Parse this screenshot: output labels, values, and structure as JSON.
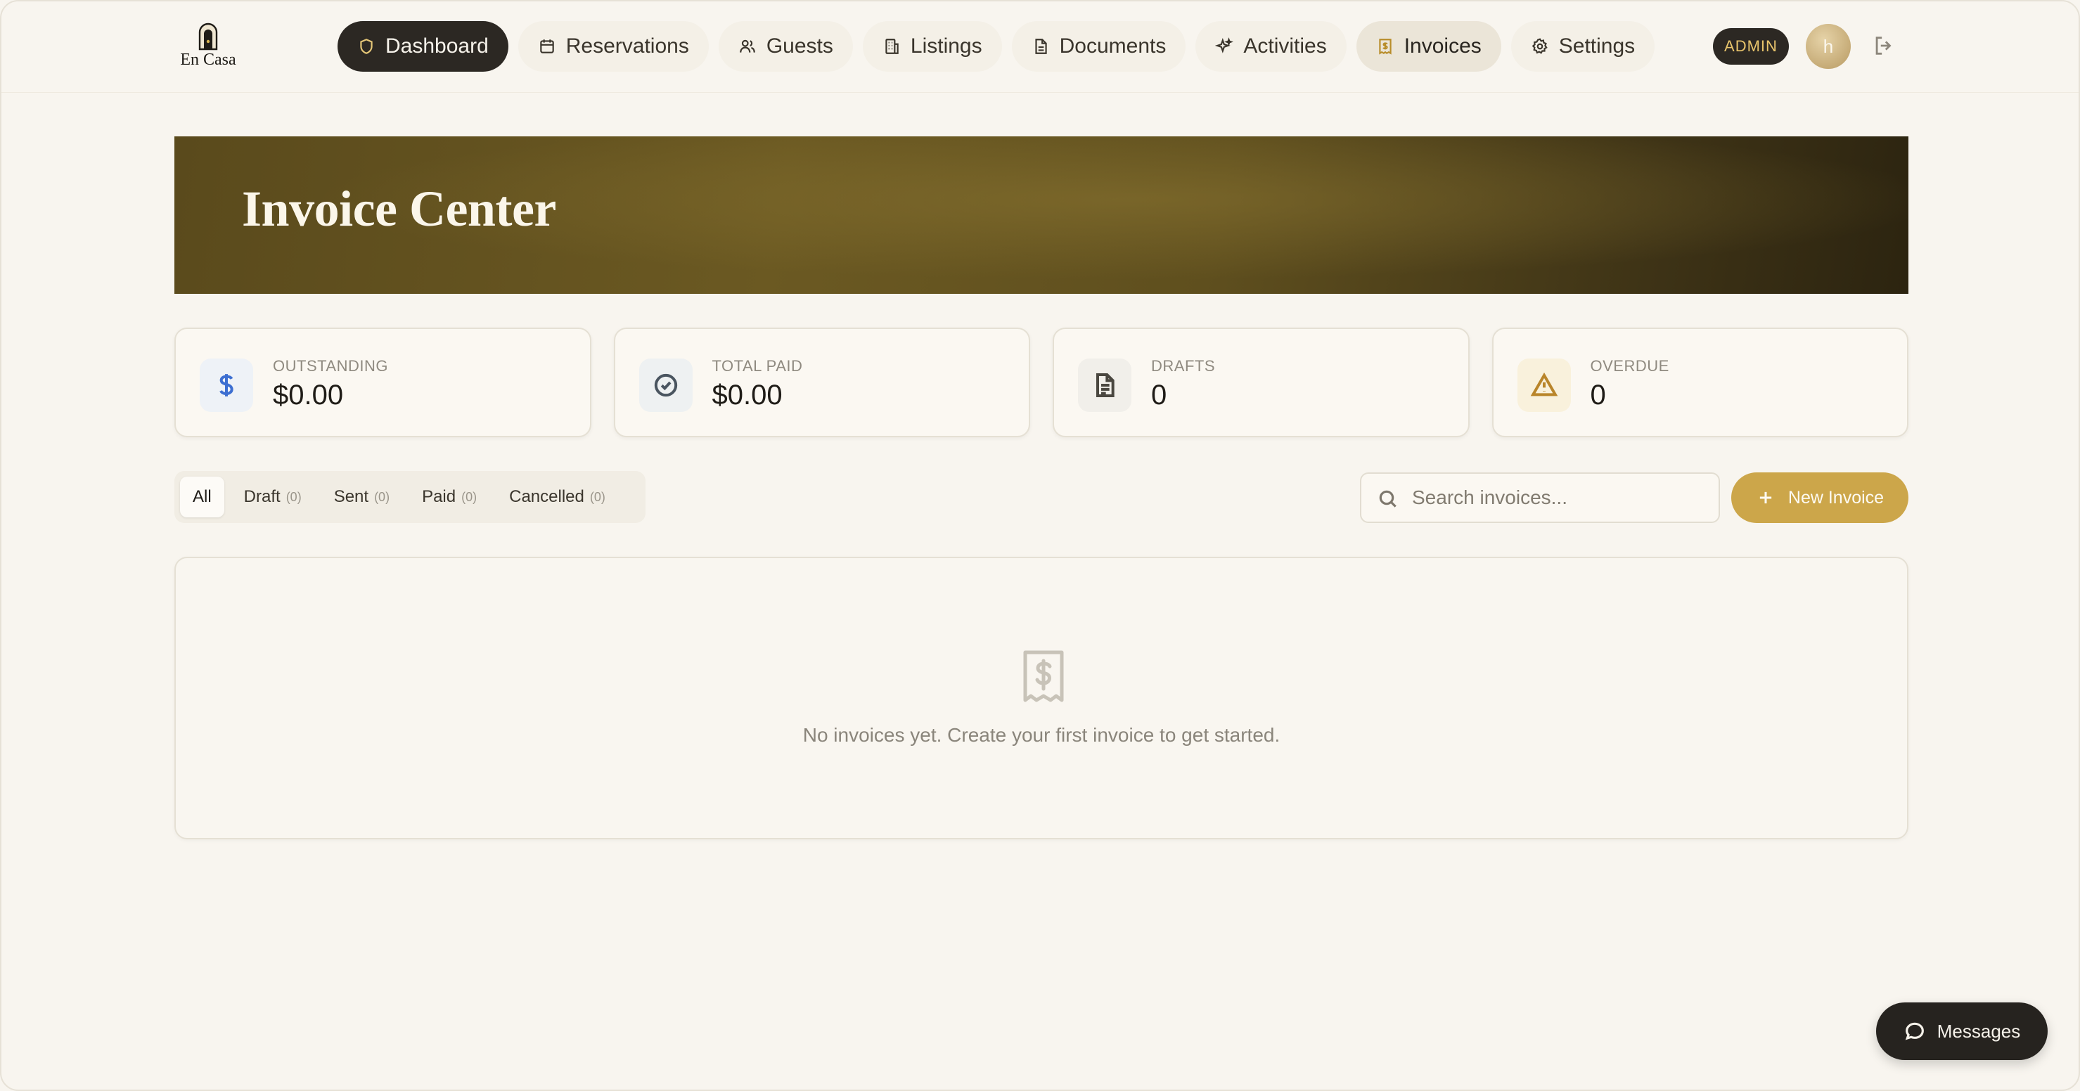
{
  "app": {
    "logo_text": "En Casa"
  },
  "nav": {
    "items": [
      {
        "label": "Dashboard",
        "icon": "shield-icon",
        "state": "active"
      },
      {
        "label": "Reservations",
        "icon": "calendar-icon",
        "state": "normal"
      },
      {
        "label": "Guests",
        "icon": "users-icon",
        "state": "normal"
      },
      {
        "label": "Listings",
        "icon": "building-icon",
        "state": "normal"
      },
      {
        "label": "Documents",
        "icon": "document-icon",
        "state": "normal"
      },
      {
        "label": "Activities",
        "icon": "sparkles-icon",
        "state": "normal"
      },
      {
        "label": "Invoices",
        "icon": "receipt-icon",
        "state": "selected"
      },
      {
        "label": "Settings",
        "icon": "gear-icon",
        "state": "normal"
      }
    ],
    "admin_badge": "ADMIN",
    "avatar_initial": "h"
  },
  "hero": {
    "title": "Invoice Center"
  },
  "stats": [
    {
      "label": "OUTSTANDING",
      "value": "$0.00",
      "icon": "dollar-icon",
      "icon_color": "#3d6fd1",
      "icon_bg": "#eef2f7"
    },
    {
      "label": "TOTAL PAID",
      "value": "$0.00",
      "icon": "check-circle-icon",
      "icon_color": "#4a5560",
      "icon_bg": "#eef1f2"
    },
    {
      "label": "DRAFTS",
      "value": "0",
      "icon": "file-text-icon",
      "icon_color": "#4a4740",
      "icon_bg": "#f1efea"
    },
    {
      "label": "OVERDUE",
      "value": "0",
      "icon": "warning-icon",
      "icon_color": "#b9852a",
      "icon_bg": "#f9f1dc"
    }
  ],
  "filters": [
    {
      "label": "All",
      "count": "",
      "active": true
    },
    {
      "label": "Draft",
      "count": "(0)",
      "active": false
    },
    {
      "label": "Sent",
      "count": "(0)",
      "active": false
    },
    {
      "label": "Paid",
      "count": "(0)",
      "active": false
    },
    {
      "label": "Cancelled",
      "count": "(0)",
      "active": false
    }
  ],
  "search": {
    "placeholder": "Search invoices...",
    "value": ""
  },
  "actions": {
    "new_invoice_label": "New Invoice"
  },
  "empty_state": {
    "message": "No invoices yet. Create your first invoice to get started."
  },
  "messages": {
    "label": "Messages"
  },
  "colors": {
    "accent": "#cca64a",
    "dark": "#2c2823",
    "background": "#f8f5ef"
  }
}
